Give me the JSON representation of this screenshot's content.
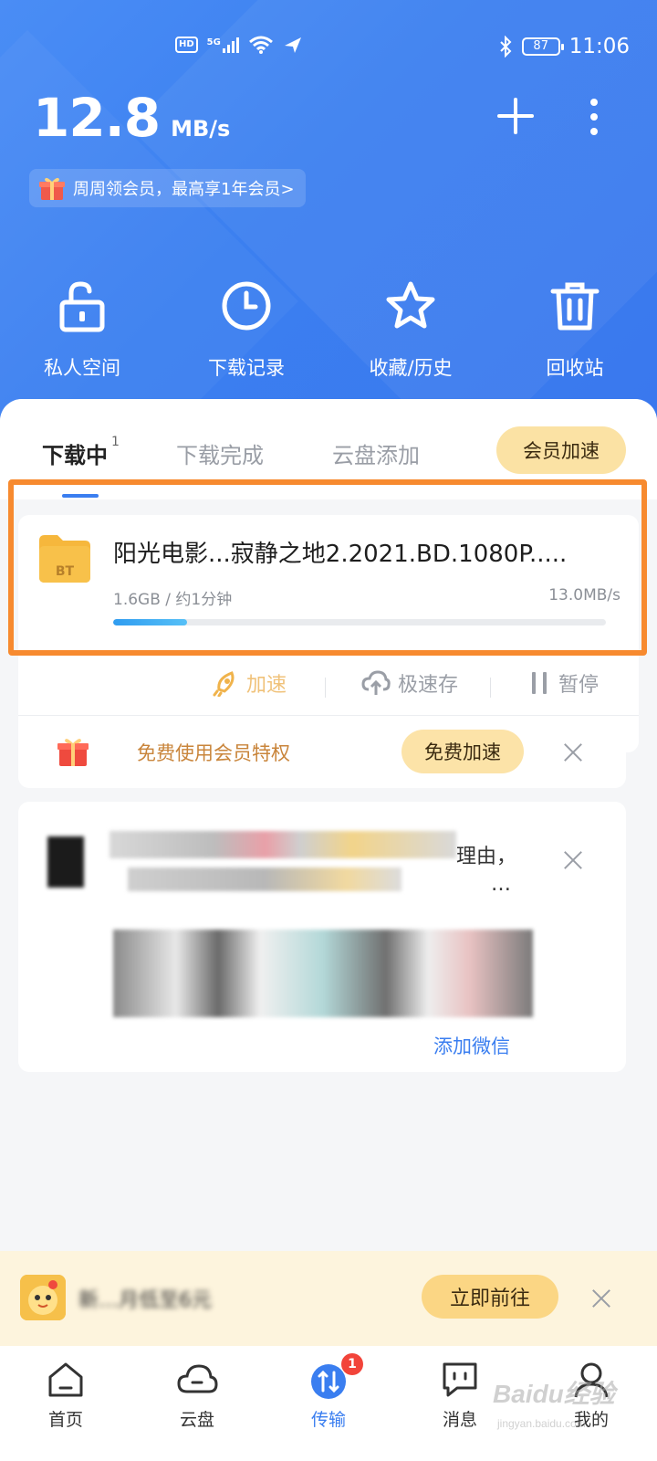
{
  "status_bar": {
    "hd": "HD",
    "signal": "5G",
    "battery": "87",
    "time": "11:06"
  },
  "header": {
    "speed_value": "12.8",
    "speed_unit": "MB/s",
    "promo_text": "周周领会员，最高享1年会员>"
  },
  "quick_actions": [
    {
      "label": "私人空间",
      "icon": "lock-open-icon"
    },
    {
      "label": "下载记录",
      "icon": "clock-icon"
    },
    {
      "label": "收藏/历史",
      "icon": "star-icon"
    },
    {
      "label": "回收站",
      "icon": "trash-icon"
    }
  ],
  "tabs": {
    "downloading": "下载中",
    "downloading_count": "1",
    "completed": "下载完成",
    "cloud_add": "云盘添加",
    "vip_boost": "会员加速"
  },
  "task": {
    "name": "阳光电影...寂静之地2.2021.BD.1080P.....",
    "meta": "1.6GB / 约1分钟",
    "rate": "13.0MB/s",
    "progress": 0.15,
    "folder_label": "BT",
    "actions": {
      "boost": "加速",
      "cloud_save": "极速存",
      "pause": "暂停"
    }
  },
  "free_promo": {
    "text": "免费使用会员特权",
    "button": "免费加速"
  },
  "ad": {
    "snippet_line1": "理由，",
    "snippet_line2": "…",
    "link": "添加微信"
  },
  "bottom_promo": {
    "text": "新…月低至6元",
    "button": "立即前往"
  },
  "tabbar": [
    {
      "label": "首页",
      "icon": "home-icon"
    },
    {
      "label": "云盘",
      "icon": "cloud-icon"
    },
    {
      "label": "传输",
      "icon": "transfer-icon",
      "badge": "1"
    },
    {
      "label": "消息",
      "icon": "message-icon"
    },
    {
      "label": "我的",
      "icon": "profile-icon"
    }
  ],
  "watermark": {
    "brand": "Baidu经验",
    "url": "jingyan.baidu.com"
  },
  "colors": {
    "header_blue": "#3b7ff0",
    "accent_blue": "#3a7ef0",
    "highlight_orange": "#f78a2f",
    "vip_gold": "#fbe2a4"
  }
}
